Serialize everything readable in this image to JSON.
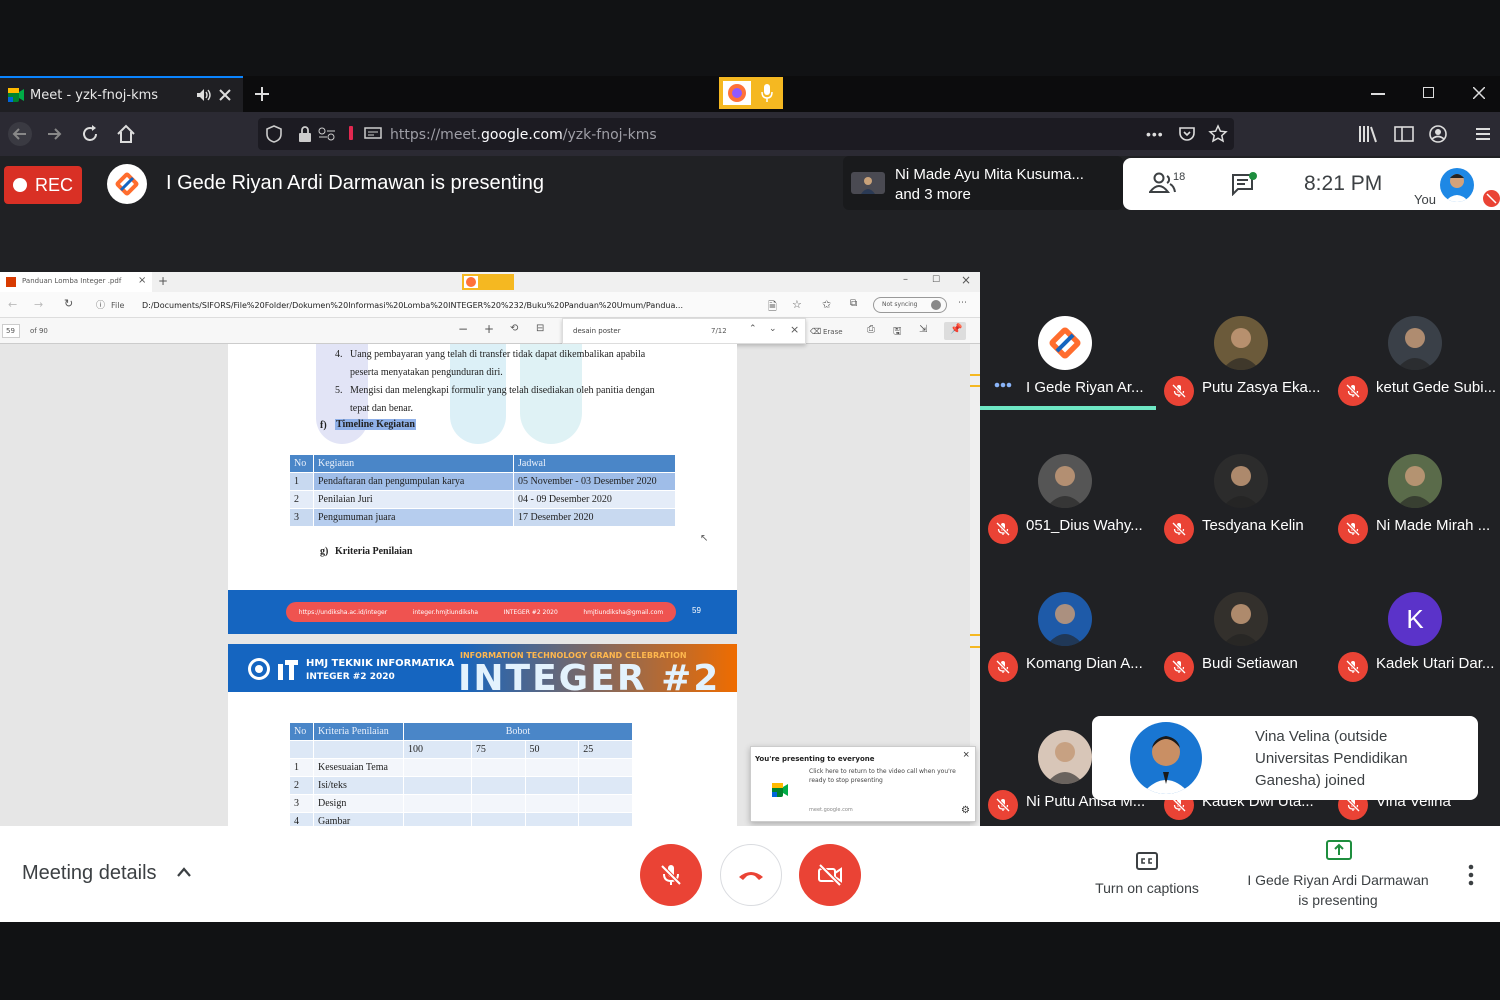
{
  "browser": {
    "tab_title": "Meet - yzk-fnoj-kms",
    "url_prefix": "https://meet.",
    "url_domain": "google.com",
    "url_path": "/yzk-fnoj-kms"
  },
  "meet": {
    "rec_label": "REC",
    "presenting_banner": "I Gede Riyan Ardi Darmawan is presenting",
    "pinned_names": "Ni Made Ayu Mita Kusuma...",
    "pinned_more": "and 3 more",
    "participant_count": "18",
    "time": "8:21  PM",
    "self_label": "You"
  },
  "shared_screen": {
    "tab_title": "Panduan Lomba Integer .pdf",
    "file_label": "File",
    "path": "D:/Documents/SIFORS/File%20Folder/Dokumen%20Informasi%20Lomba%20INTEGER%20%232/Buku%20Panduan%20Umum/Pandua...",
    "sync_label": "Not syncing",
    "page_num": "59",
    "page_of": "of 90",
    "find_text": "desain poster",
    "find_count": "7/12",
    "erase_label": "Erase",
    "items": [
      {
        "num": "4.",
        "text": "Uang pembayaran yang telah di transfer tidak dapat dikembalikan apabila",
        "cont": "peserta menyatakan pengunduran diri."
      },
      {
        "num": "5.",
        "text": "Mengisi dan melengkapi formulir yang telah disediakan oleh panitia dengan",
        "cont": "tepat dan benar."
      }
    ],
    "section_f": "f)",
    "timeline_heading": "Timeline Kegiatan",
    "timeline_headers": [
      "No",
      "Kegiatan",
      "Jadwal"
    ],
    "timeline_rows": [
      [
        "1",
        "Pendaftaran dan pengumpulan karya",
        "05 November - 03 Desember 2020"
      ],
      [
        "2",
        "Penilaian Juri",
        "04 - 09 Desember 2020"
      ],
      [
        "3",
        "Pengumuman juara",
        "17 Desember 2020"
      ]
    ],
    "section_g": "g)",
    "criteria_heading": "Kriteria Penilaian",
    "footer_links": [
      "https://undiksha.ac.id/integer",
      "integer.hmjtiundiksha",
      "INTEGER #2 2020",
      "hmjtiundiksha@gmail.com"
    ],
    "footer_page": "59",
    "banner_org": "HMJ TEKNIK INFORMATIKA",
    "banner_sub": "INTEGER #2 2020",
    "banner_event": "INFORMATION TECHNOLOGY GRAND CELEBRATION",
    "banner_title": "INTEGER #2",
    "criteria_headers": [
      "No",
      "Kriteria Penilaian",
      "Bobot"
    ],
    "bobot_values": [
      "100",
      "75",
      "50",
      "25"
    ],
    "criteria_rows": [
      [
        "1",
        "Kesesuaian Tema"
      ],
      [
        "2",
        "Isi/teks"
      ],
      [
        "3",
        "Design"
      ],
      [
        "4",
        "Gambar"
      ]
    ],
    "popup_title": "You're presenting to everyone",
    "popup_text": "Click here to return to the video call when you're ready to stop presenting",
    "popup_url": "meet.google.com"
  },
  "participants": [
    {
      "name": "I Gede Riyan Ar...",
      "avatar_color": "#ffffff",
      "muted": false,
      "speaking": true
    },
    {
      "name": "Putu Zasya Eka...",
      "avatar_color": "#6b5a3a",
      "muted": true
    },
    {
      "name": "ketut Gede Subi...",
      "avatar_color": "#3a4048",
      "muted": true
    },
    {
      "name": "051_Dius Wahy...",
      "avatar_color": "#555555",
      "muted": true
    },
    {
      "name": "Tesdyana Kelin",
      "avatar_color": "#2c2c2c",
      "muted": true
    },
    {
      "name": "Ni Made Mirah ...",
      "avatar_color": "#5a6b4a",
      "muted": true
    },
    {
      "name": "Komang Dian A...",
      "avatar_color": "#1e5aa8",
      "muted": true
    },
    {
      "name": "Budi Setiawan",
      "avatar_color": "#33302c",
      "muted": true
    },
    {
      "name": "Kadek Utari Dar...",
      "avatar_color": "#5b33c9",
      "initial": "K",
      "muted": true
    },
    {
      "name": "Ni Putu Anisa M...",
      "avatar_color": "#d8c6b8",
      "muted": true
    },
    {
      "name": "Kadek Dwi Uta...",
      "avatar_color": "#444444",
      "muted": true
    },
    {
      "name": "Vina Velina",
      "avatar_color": "#444444",
      "muted": true
    }
  ],
  "toast": {
    "text": "Vina Velina (outside Universitas Pendidikan Ganesha) joined"
  },
  "controls": {
    "meeting_details": "Meeting details",
    "captions_label": "Turn on captions",
    "presenting_label_1": "I Gede Riyan Ardi Darmawan",
    "presenting_label_2": "is presenting"
  },
  "colors": {
    "red": "#ea4335",
    "rec_red": "#d93025",
    "accent_green": "#1e8e3e",
    "meet_dark": "#202124"
  }
}
